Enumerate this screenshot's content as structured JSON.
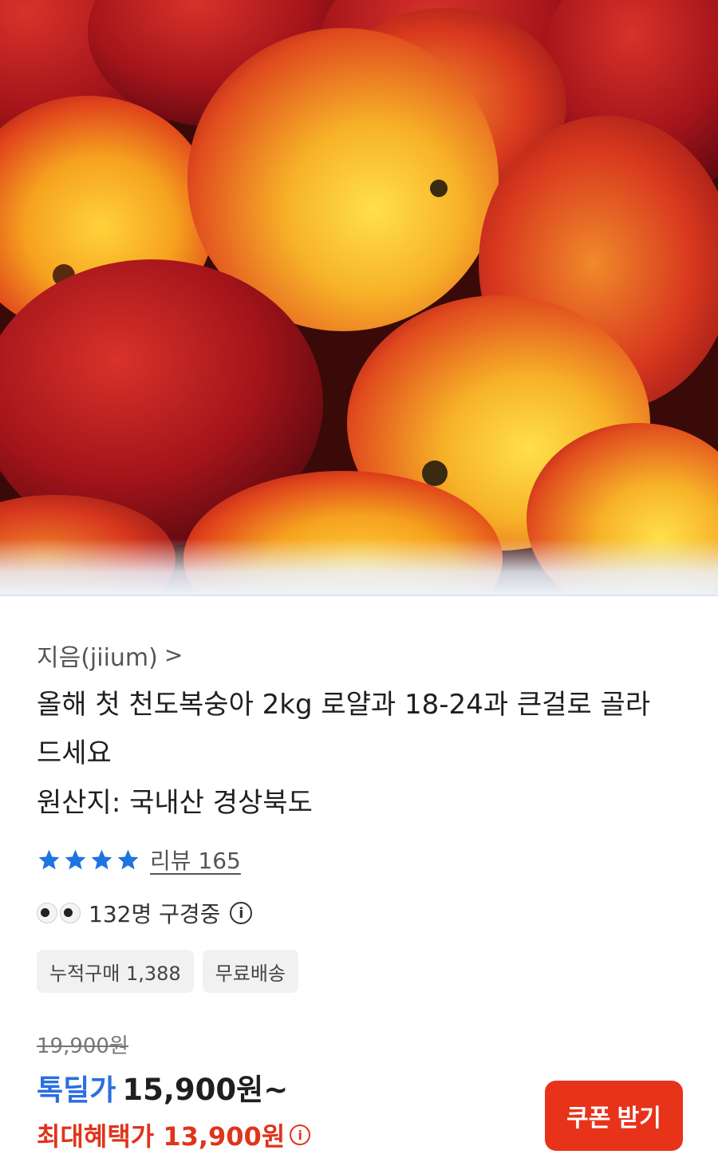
{
  "seller": {
    "name": "지음(jiium)",
    "chevron": ">"
  },
  "product": {
    "title": "올해 첫 천도복숭아 2kg 로얄과 18-24과 큰걸로 골라드세요",
    "origin": "원산지: 국내산 경상북도"
  },
  "rating": {
    "stars": 4,
    "max_stars": 4,
    "review_text": "리뷰 165",
    "star_color": "#1e74e0"
  },
  "viewers": {
    "text": "132명 구경중",
    "icon": "eyes-emoji"
  },
  "chips": [
    {
      "label": "누적구매 1,388"
    },
    {
      "label": "무료배송"
    }
  ],
  "pricing": {
    "original": "19,900원",
    "deal_label": "톡딜가",
    "deal_price": "15,900원~",
    "max_benefit": "최대혜택가 13,900원"
  },
  "coupon_button": {
    "label": "쿠폰 받기"
  },
  "colors": {
    "deal_blue": "#2a6ee0",
    "benefit_red": "#e0341c",
    "button_red": "#e8331b"
  }
}
